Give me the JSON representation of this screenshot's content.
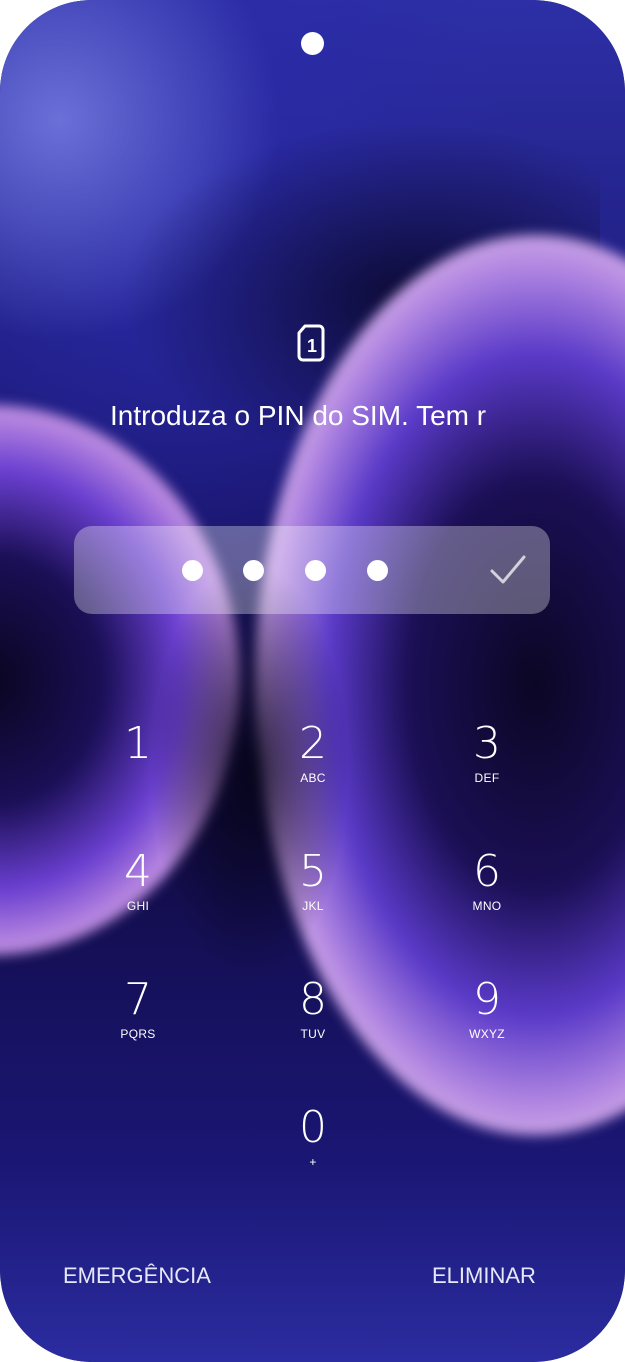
{
  "lock_screen": {
    "prompt": "Introduza o PIN do SIM. Tem r",
    "sim_icon_label": "1",
    "pin_length": 4,
    "confirm_icon": "checkmark-icon",
    "sim_icon": "sim-card-icon"
  },
  "keypad": {
    "keys": [
      {
        "digit": "1",
        "letters": ""
      },
      {
        "digit": "2",
        "letters": "ABC"
      },
      {
        "digit": "3",
        "letters": "DEF"
      },
      {
        "digit": "4",
        "letters": "GHI"
      },
      {
        "digit": "5",
        "letters": "JKL"
      },
      {
        "digit": "6",
        "letters": "MNO"
      },
      {
        "digit": "7",
        "letters": "PQRS"
      },
      {
        "digit": "8",
        "letters": "TUV"
      },
      {
        "digit": "9",
        "letters": "WXYZ"
      },
      {
        "digit": "0",
        "letters": "+"
      }
    ]
  },
  "actions": {
    "emergency": "EMERGÊNCIA",
    "delete": "ELIMINAR"
  }
}
